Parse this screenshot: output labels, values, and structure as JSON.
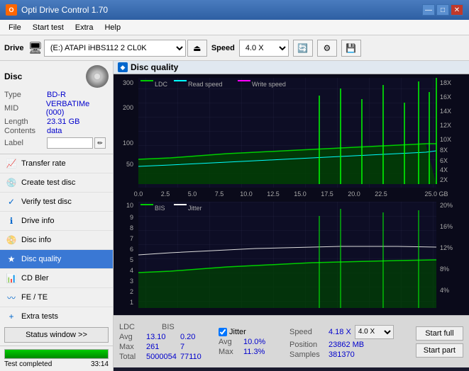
{
  "app": {
    "title": "Opti Drive Control 1.70",
    "icon": "O"
  },
  "title_controls": {
    "minimize": "—",
    "maximize": "□",
    "close": "✕"
  },
  "menu": {
    "items": [
      "File",
      "Start test",
      "Extra",
      "Help"
    ]
  },
  "toolbar": {
    "drive_label": "Drive",
    "drive_value": "(E:)  ATAPI iHBS112  2 CL0K",
    "speed_label": "Speed",
    "speed_value": "4.0 X"
  },
  "disc_section": {
    "label": "Disc",
    "type_key": "Type",
    "type_val": "BD-R",
    "mid_key": "MID",
    "mid_val": "VERBATIMe (000)",
    "length_key": "Length",
    "length_val": "23.31 GB",
    "contents_key": "Contents",
    "contents_val": "data",
    "label_key": "Label",
    "label_placeholder": ""
  },
  "nav": {
    "items": [
      {
        "id": "transfer-rate",
        "label": "Transfer rate",
        "icon": "📈"
      },
      {
        "id": "create-test-disc",
        "label": "Create test disc",
        "icon": "💿"
      },
      {
        "id": "verify-test-disc",
        "label": "Verify test disc",
        "icon": "✓"
      },
      {
        "id": "drive-info",
        "label": "Drive info",
        "icon": "ℹ"
      },
      {
        "id": "disc-info",
        "label": "Disc info",
        "icon": "📀"
      },
      {
        "id": "disc-quality",
        "label": "Disc quality",
        "icon": "★",
        "active": true
      },
      {
        "id": "cd-bler",
        "label": "CD Bler",
        "icon": "📊"
      },
      {
        "id": "fe-te",
        "label": "FE / TE",
        "icon": "〰"
      },
      {
        "id": "extra-tests",
        "label": "Extra tests",
        "icon": "+"
      }
    ]
  },
  "status_button": "Status window >>",
  "progress": {
    "percent": 100,
    "percent_text": "100.0%",
    "status_text": "Test completed",
    "time_text": "33:14"
  },
  "chart": {
    "title": "Disc quality",
    "legend_top": {
      "ldc_label": "LDC",
      "ldc_color": "#00aa00",
      "read_label": "Read speed",
      "read_color": "#00ffff",
      "write_label": "Write speed",
      "write_color": "#ff00ff"
    },
    "legend_bottom": {
      "bis_label": "BIS",
      "bis_color": "#00aa00",
      "jitter_label": "Jitter",
      "jitter_color": "#ffffff"
    },
    "top_y_left": [
      "300",
      "200",
      "100",
      "50"
    ],
    "top_y_right": [
      "18X",
      "16X",
      "14X",
      "12X",
      "10X",
      "8X",
      "6X",
      "4X",
      "2X"
    ],
    "bottom_y_left": [
      "10",
      "9",
      "8",
      "7",
      "6",
      "5",
      "4",
      "3",
      "2",
      "1"
    ],
    "bottom_y_right": [
      "20%",
      "16%",
      "12%",
      "8%",
      "4%"
    ],
    "x_labels": [
      "0.0",
      "2.5",
      "5.0",
      "7.5",
      "10.0",
      "12.5",
      "15.0",
      "17.5",
      "20.0",
      "22.5",
      "25.0 GB"
    ]
  },
  "stats": {
    "columns": [
      "LDC",
      "BIS"
    ],
    "rows": [
      {
        "label": "Avg",
        "ldc": "13.10",
        "bis": "0.20"
      },
      {
        "label": "Max",
        "ldc": "261",
        "bis": "7"
      },
      {
        "label": "Total",
        "ldc": "5000054",
        "bis": "77110"
      }
    ],
    "jitter_checked": true,
    "jitter_label": "Jitter",
    "jitter_avg": "10.0%",
    "jitter_max": "11.3%",
    "speed_label": "Speed",
    "speed_val": "4.18 X",
    "speed_select": "4.0 X",
    "position_label": "Position",
    "position_val": "23862 MB",
    "samples_label": "Samples",
    "samples_val": "381370",
    "btn_start_full": "Start full",
    "btn_start_part": "Start part"
  }
}
